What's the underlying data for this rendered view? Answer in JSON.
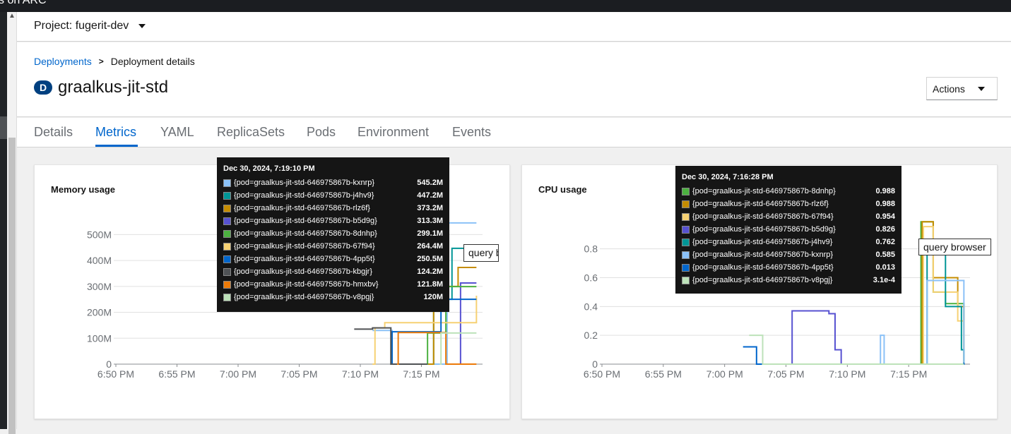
{
  "topbar": {
    "text": "s on ARC"
  },
  "project": {
    "label": "Project: fugerit-dev"
  },
  "breadcrumb": {
    "parent": "Deployments",
    "current": "Deployment details"
  },
  "deployment": {
    "badge": "D",
    "name": "graalkus-jit-std"
  },
  "actions": {
    "label": "Actions"
  },
  "tabs": [
    "Details",
    "Metrics",
    "YAML",
    "ReplicaSets",
    "Pods",
    "Environment",
    "Events"
  ],
  "memory": {
    "title": "Memory usage",
    "tooltip": {
      "time": "Dec 30, 2024, 7:19:10 PM",
      "rows": [
        {
          "name": "{pod=graalkus-jit-std-646975867b-kxnrp}",
          "value": "545.2M",
          "color": "#8bc1f7"
        },
        {
          "name": "{pod=graalkus-jit-std-646975867b-j4hv9}",
          "value": "447.2M",
          "color": "#009596"
        },
        {
          "name": "{pod=graalkus-jit-std-646975867b-rlz6f}",
          "value": "373.2M",
          "color": "#c58c00"
        },
        {
          "name": "{pod=graalkus-jit-std-646975867b-b5d9g}",
          "value": "313.3M",
          "color": "#5752d1"
        },
        {
          "name": "{pod=graalkus-jit-std-646975867b-8dnhp}",
          "value": "299.1M",
          "color": "#4cb140"
        },
        {
          "name": "{pod=graalkus-jit-std-646975867b-67f94}",
          "value": "264.4M",
          "color": "#f6d173"
        },
        {
          "name": "{pod=graalkus-jit-std-646975867b-4pp5t}",
          "value": "250.5M",
          "color": "#0066cc"
        },
        {
          "name": "{pod=graalkus-jit-std-646975867b-kbgjr}",
          "value": "124.2M",
          "color": "#4f5255"
        },
        {
          "name": "{pod=graalkus-jit-std-646975867b-hmxbv}",
          "value": "121.8M",
          "color": "#ec7a08"
        },
        {
          "name": "{pod=graalkus-jit-std-646975867b-v8pgj}",
          "value": "120M",
          "color": "#bde2b9"
        }
      ]
    },
    "query_tip": "query browser"
  },
  "cpu": {
    "title": "CPU usage",
    "tooltip": {
      "time": "Dec 30, 2024, 7:16:28 PM",
      "rows": [
        {
          "name": "{pod=graalkus-jit-std-646975867b-8dnhp}",
          "value": "0.988",
          "color": "#4cb140"
        },
        {
          "name": "{pod=graalkus-jit-std-646975867b-rlz6f}",
          "value": "0.988",
          "color": "#c58c00"
        },
        {
          "name": "{pod=graalkus-jit-std-646975867b-67f94}",
          "value": "0.954",
          "color": "#f6d173"
        },
        {
          "name": "{pod=graalkus-jit-std-646975867b-b5d9g}",
          "value": "0.826",
          "color": "#5752d1"
        },
        {
          "name": "{pod=graalkus-jit-std-646975867b-j4hv9}",
          "value": "0.762",
          "color": "#009596"
        },
        {
          "name": "{pod=graalkus-jit-std-646975867b-kxnrp}",
          "value": "0.585",
          "color": "#8bc1f7"
        },
        {
          "name": "{pod=graalkus-jit-std-646975867b-4pp5t}",
          "value": "0.013",
          "color": "#0066cc"
        },
        {
          "name": "{pod=graalkus-jit-std-646975867b-v8pgj}",
          "value": "3.1e-4",
          "color": "#bde2b9"
        }
      ]
    },
    "query_tip": "query browser"
  },
  "chart_data": [
    {
      "type": "line",
      "title": "Memory usage",
      "xlabel": "",
      "ylabel": "",
      "x_ticks": [
        "6:50 PM",
        "6:55 PM",
        "7:00 PM",
        "7:05 PM",
        "7:10 PM",
        "7:15 PM"
      ],
      "y_ticks": [
        "0",
        "100M",
        "200M",
        "300M",
        "400M",
        "500M"
      ],
      "ylim": [
        0,
        550
      ],
      "xlim_minutes": [
        0,
        30
      ],
      "grid": true,
      "series": [
        {
          "pod": "kxnrp",
          "color": "#8bc1f7",
          "points": [
            [
              21,
              130
            ],
            [
              22.5,
              130
            ],
            [
              22.6,
              0
            ],
            [
              27,
              0
            ],
            [
              27.1,
              545
            ],
            [
              29.5,
              545
            ]
          ]
        },
        {
          "pod": "j4hv9",
          "color": "#009596",
          "points": [
            [
              25.5,
              0
            ],
            [
              26,
              250
            ],
            [
              27,
              250
            ],
            [
              27.5,
              447
            ],
            [
              29.5,
              447
            ]
          ]
        },
        {
          "pod": "rlz6f",
          "color": "#c58c00",
          "points": [
            [
              25.5,
              0
            ],
            [
              26,
              300
            ],
            [
              28,
              373
            ],
            [
              29.5,
              373
            ]
          ]
        },
        {
          "pod": "b5d9g",
          "color": "#5752d1",
          "points": [
            [
              28,
              0
            ],
            [
              28.2,
              313
            ],
            [
              29.5,
              313
            ]
          ]
        },
        {
          "pod": "8dnhp",
          "color": "#4cb140",
          "points": [
            [
              25,
              0
            ],
            [
              25.5,
              120
            ],
            [
              27,
              299
            ],
            [
              29.5,
              299
            ]
          ]
        },
        {
          "pod": "67f94",
          "color": "#f6d173",
          "points": [
            [
              21,
              0
            ],
            [
              21.2,
              140
            ],
            [
              22,
              160
            ],
            [
              29.5,
              264
            ]
          ]
        },
        {
          "pod": "4pp5t",
          "color": "#0066cc",
          "points": [
            [
              22.5,
              0
            ],
            [
              22.6,
              125
            ],
            [
              26.5,
              125
            ],
            [
              26.6,
              250
            ],
            [
              29.5,
              250
            ]
          ]
        },
        {
          "pod": "kbgjr",
          "color": "#4f5255",
          "points": [
            [
              19.5,
              135
            ],
            [
              20.5,
              135
            ],
            [
              21,
              140
            ],
            [
              22,
              140
            ],
            [
              22.5,
              0
            ],
            [
              25.5,
              0
            ]
          ]
        },
        {
          "pod": "hmxbv",
          "color": "#ec7a08",
          "points": [
            [
              23,
              0
            ],
            [
              23.1,
              122
            ],
            [
              26.5,
              122
            ],
            [
              27,
              0
            ],
            [
              29.5,
              0
            ]
          ]
        },
        {
          "pod": "v8pgj",
          "color": "#bde2b9",
          "points": [
            [
              26.5,
              0
            ],
            [
              26.6,
              120
            ],
            [
              29.5,
              120
            ]
          ]
        }
      ]
    },
    {
      "type": "line",
      "title": "CPU usage",
      "xlabel": "",
      "ylabel": "",
      "x_ticks": [
        "6:50 PM",
        "6:55 PM",
        "7:00 PM",
        "7:05 PM",
        "7:10 PM",
        "7:15 PM"
      ],
      "y_ticks": [
        "0",
        "0.2",
        "0.4",
        "0.6",
        "0.8"
      ],
      "ylim": [
        0,
        0.95
      ],
      "xlim_minutes": [
        0,
        30
      ],
      "grid": true,
      "series": [
        {
          "pod": "8dnhp",
          "color": "#4cb140",
          "points": [
            [
              25.5,
              0
            ],
            [
              26,
              0.988
            ],
            [
              27,
              0.5
            ],
            [
              28,
              0.42
            ],
            [
              29.5,
              0
            ]
          ]
        },
        {
          "pod": "rlz6f",
          "color": "#c58c00",
          "points": [
            [
              25.8,
              0
            ],
            [
              26.1,
              0.988
            ],
            [
              27,
              0.6
            ],
            [
              29,
              0.4
            ],
            [
              29.5,
              0
            ]
          ]
        },
        {
          "pod": "67f94",
          "color": "#f6d173",
          "points": [
            [
              25.8,
              0
            ],
            [
              26.2,
              0.954
            ],
            [
              27,
              0.5
            ],
            [
              29,
              0.3
            ],
            [
              29.5,
              0
            ]
          ]
        },
        {
          "pod": "b5d9g",
          "color": "#5752d1",
          "points": [
            [
              15,
              0
            ],
            [
              15.5,
              0.37
            ],
            [
              18.5,
              0.35
            ],
            [
              19,
              0.1
            ],
            [
              19.5,
              0
            ]
          ]
        },
        {
          "pod": "j4hv9",
          "color": "#009596",
          "points": [
            [
              26,
              0
            ],
            [
              26.5,
              0.76
            ],
            [
              28,
              0.4
            ],
            [
              29.3,
              0.1
            ],
            [
              29.5,
              0
            ]
          ]
        },
        {
          "pod": "kxnrp",
          "color": "#8bc1f7",
          "points": [
            [
              22.5,
              0
            ],
            [
              22.7,
              0.2
            ],
            [
              23,
              0
            ],
            [
              26.5,
              0.58
            ],
            [
              29.5,
              0
            ]
          ]
        },
        {
          "pod": "4pp5t",
          "color": "#0066cc",
          "points": [
            [
              11.5,
              0.12
            ],
            [
              12.5,
              0.12
            ],
            [
              12.6,
              0
            ],
            [
              29.5,
              0.01
            ]
          ]
        },
        {
          "pod": "v8pgj",
          "color": "#bde2b9",
          "points": [
            [
              12,
              0.2
            ],
            [
              13,
              0.2
            ],
            [
              13.1,
              0
            ],
            [
              29.5,
              0
            ]
          ]
        }
      ]
    }
  ]
}
